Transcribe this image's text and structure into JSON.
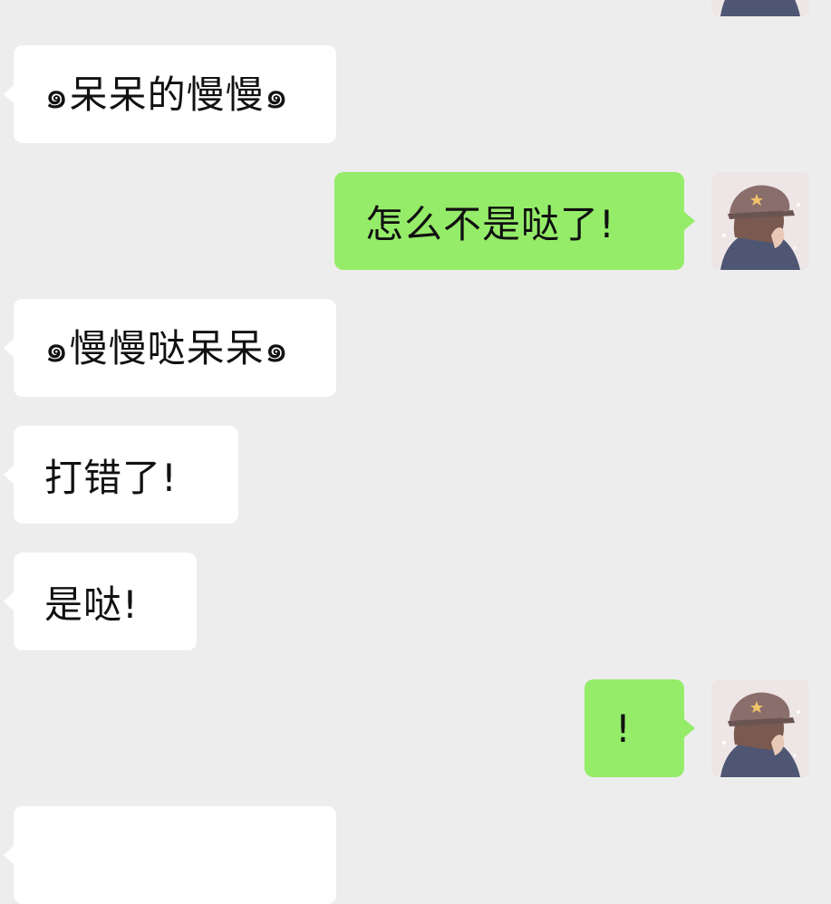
{
  "messages": [
    {
      "id": "m1",
      "side": "incoming",
      "text": "๑呆呆的慢慢๑"
    },
    {
      "id": "m2",
      "side": "outgoing",
      "text": "怎么不是哒了!"
    },
    {
      "id": "m3",
      "side": "incoming",
      "text": "๑慢慢哒呆呆๑"
    },
    {
      "id": "m4",
      "side": "incoming",
      "text": "打错了!"
    },
    {
      "id": "m5",
      "side": "incoming",
      "text": "是哒!"
    },
    {
      "id": "m6",
      "side": "outgoing",
      "text": "!"
    },
    {
      "id": "m7",
      "side": "incoming",
      "text": ""
    }
  ],
  "avatar": {
    "icon": "avatar-girl-cap-icon"
  },
  "colors": {
    "background": "#ededed",
    "incoming_bubble": "#ffffff",
    "outgoing_bubble": "#95ec69",
    "text": "#111111"
  }
}
